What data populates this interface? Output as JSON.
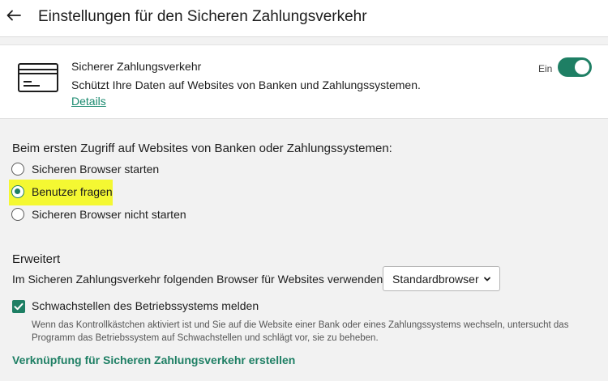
{
  "header": {
    "title": "Einstellungen für den Sicheren Zahlungsverkehr"
  },
  "card": {
    "title": "Sicherer Zahlungsverkehr",
    "description": "Schützt Ihre Daten auf Websites von Banken und Zahlungssystemen.",
    "details_link": "Details",
    "toggle_label": "Ein",
    "toggle_on": true
  },
  "access": {
    "heading": "Beim ersten Zugriff auf Websites von Banken oder Zahlungssystemen:",
    "options": [
      {
        "label": "Sicheren Browser starten",
        "selected": false
      },
      {
        "label": "Benutzer fragen",
        "selected": true
      },
      {
        "label": "Sicheren Browser nicht starten",
        "selected": false
      }
    ]
  },
  "advanced": {
    "heading": "Erweitert",
    "browser_text": "Im Sicheren Zahlungsverkehr folgenden Browser für Websites verwenden:",
    "browser_value": "Standardbrowser",
    "checkbox_label": "Schwachstellen des Betriebssystems melden",
    "checkbox_checked": true,
    "hint": "Wenn das Kontrollkästchen aktiviert ist und Sie auf die Website einer Bank oder eines Zahlungssystems wechseln, untersucht das Programm das Betriebssystem auf Schwachstellen und schlägt vor, sie zu beheben.",
    "shortcut_link": "Verknüpfung für Sicheren Zahlungsverkehr erstellen"
  },
  "colors": {
    "accent": "#1e7f64",
    "highlight": "#f4f832"
  }
}
